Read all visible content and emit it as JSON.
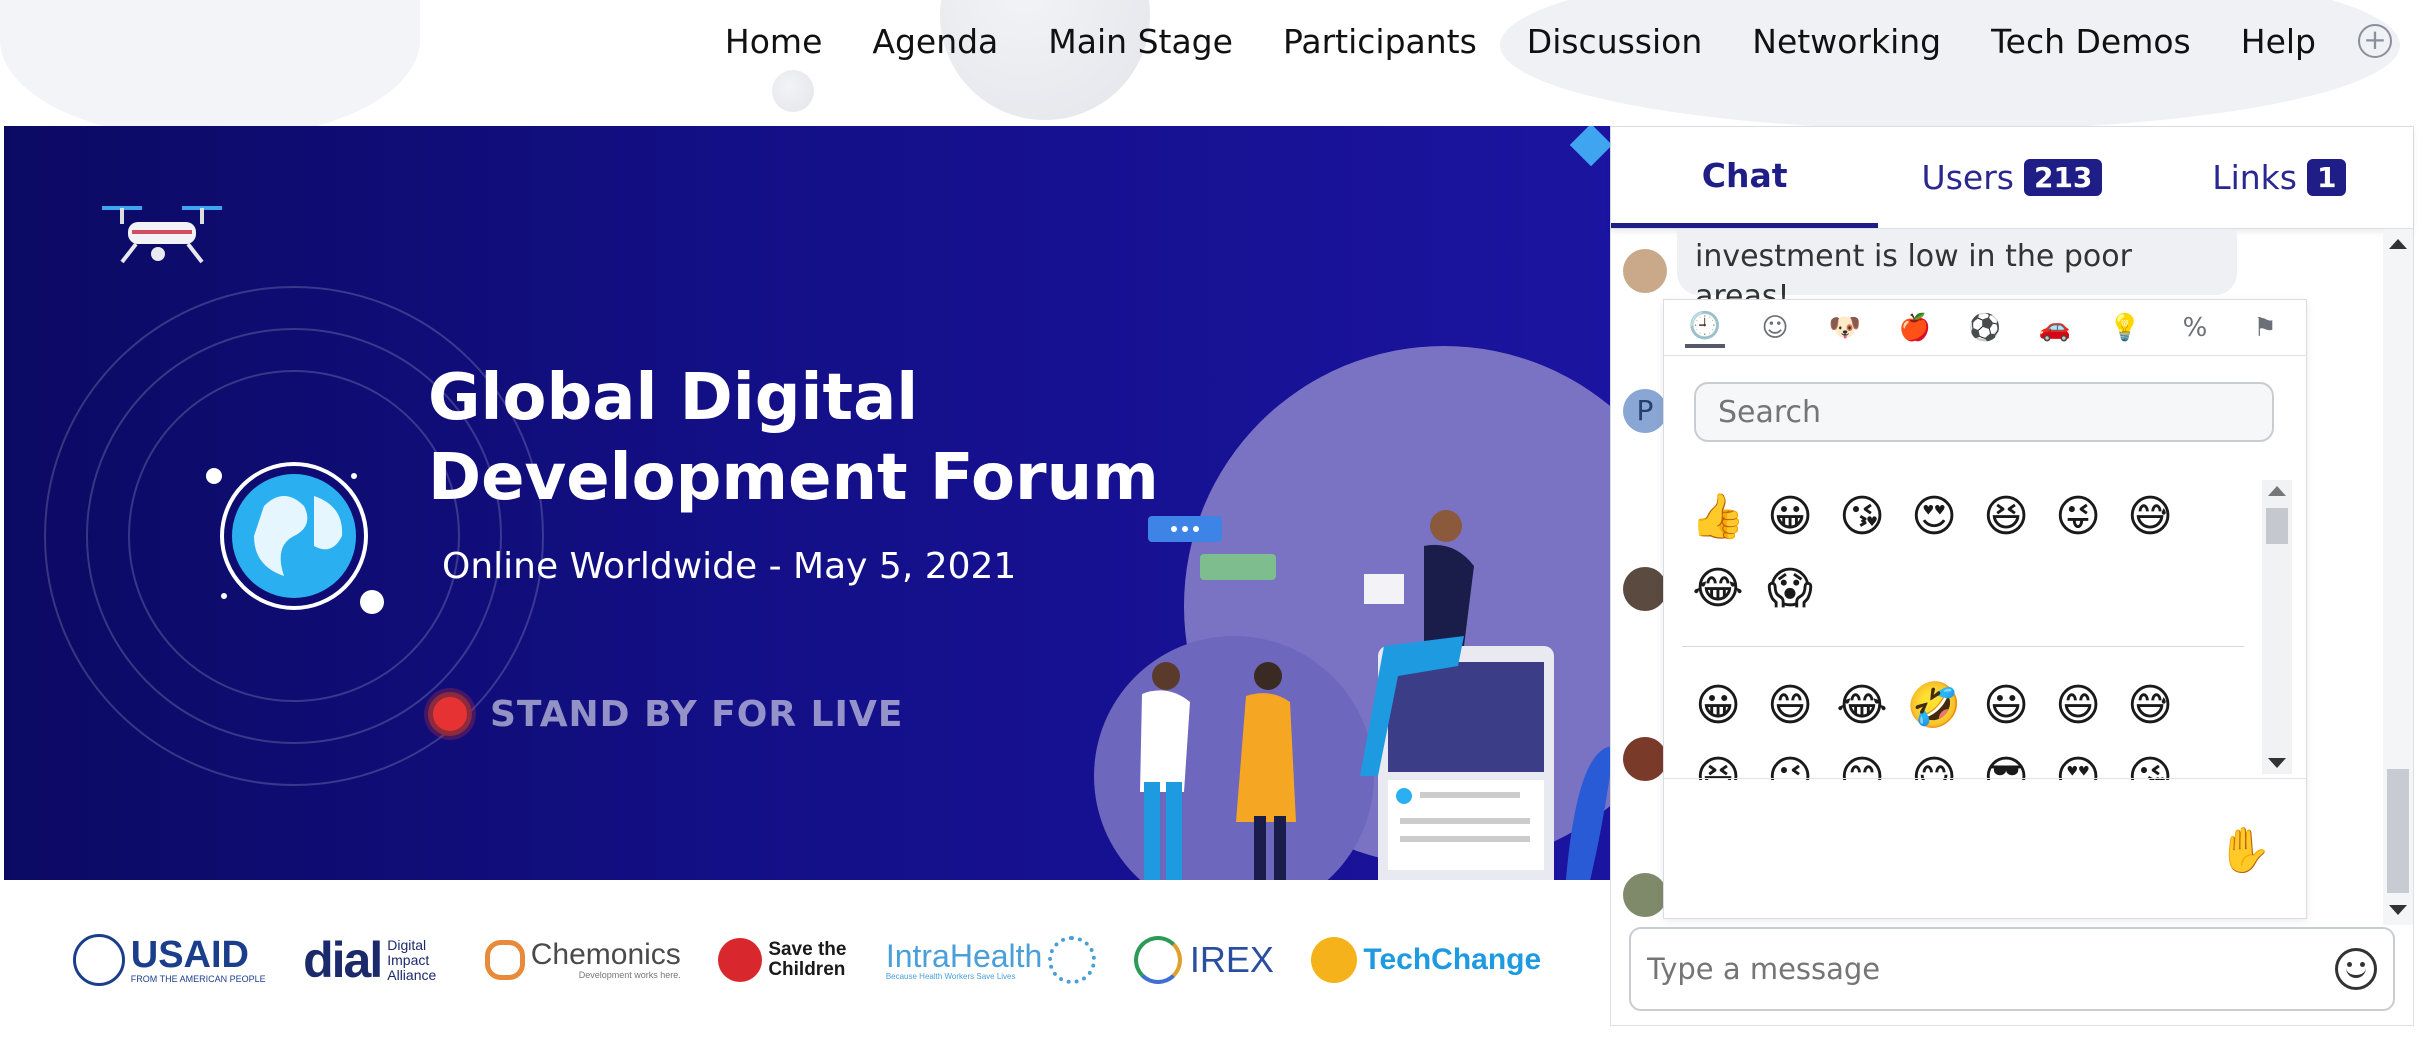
{
  "nav": {
    "items": [
      {
        "label": "Home"
      },
      {
        "label": "Agenda"
      },
      {
        "label": "Main Stage"
      },
      {
        "label": "Participants"
      },
      {
        "label": "Discussion"
      },
      {
        "label": "Networking"
      },
      {
        "label": "Tech Demos"
      },
      {
        "label": "Help"
      }
    ],
    "plus_icon": "plus-circle-icon"
  },
  "hero": {
    "title_line1": "Global Digital",
    "title_line2": "Development Forum",
    "subtitle": "Online Worldwide - May 5, 2021",
    "live_text": "STAND BY FOR LIVE",
    "background_colors": [
      "#0b0a63",
      "#1b14a0"
    ],
    "accent": "#e63232"
  },
  "sponsors": [
    {
      "name": "USAID",
      "tagline": "FROM THE AMERICAN PEOPLE"
    },
    {
      "name": "dial",
      "tagline": "Digital Impact Alliance"
    },
    {
      "name": "Chemonics",
      "tagline": "Development works here."
    },
    {
      "name": "Save the Children"
    },
    {
      "name": "IntraHealth",
      "tagline": "Because Health Workers Save Lives"
    },
    {
      "name": "IREX"
    },
    {
      "name": "TechChange"
    }
  ],
  "chat": {
    "tabs": [
      {
        "label": "Chat"
      },
      {
        "label": "Users",
        "count": "213"
      },
      {
        "label": "Links",
        "count": "1"
      }
    ],
    "active_tab": "Chat",
    "message_text": "investment is low in the poor areas!",
    "avatar_initial": "P",
    "emoji_picker": {
      "categories": [
        "recent-icon",
        "smiley-icon",
        "animal-icon",
        "food-icon",
        "activity-icon",
        "travel-icon",
        "objects-icon",
        "symbols-icon",
        "flags-icon"
      ],
      "search_placeholder": "Search",
      "recent": [
        "👍",
        "😀",
        "😘",
        "😍",
        "😆",
        "😜",
        "😅",
        "😂",
        "😱"
      ],
      "smileys": [
        "😀",
        "😄",
        "😂",
        "🤣",
        "😃",
        "😄",
        "😅"
      ],
      "smileys_partial": [
        "😆",
        "😉",
        "😊",
        "😋",
        "😎",
        "😍",
        "😘"
      ],
      "hand": "✋"
    },
    "input_placeholder": "Type a message"
  }
}
